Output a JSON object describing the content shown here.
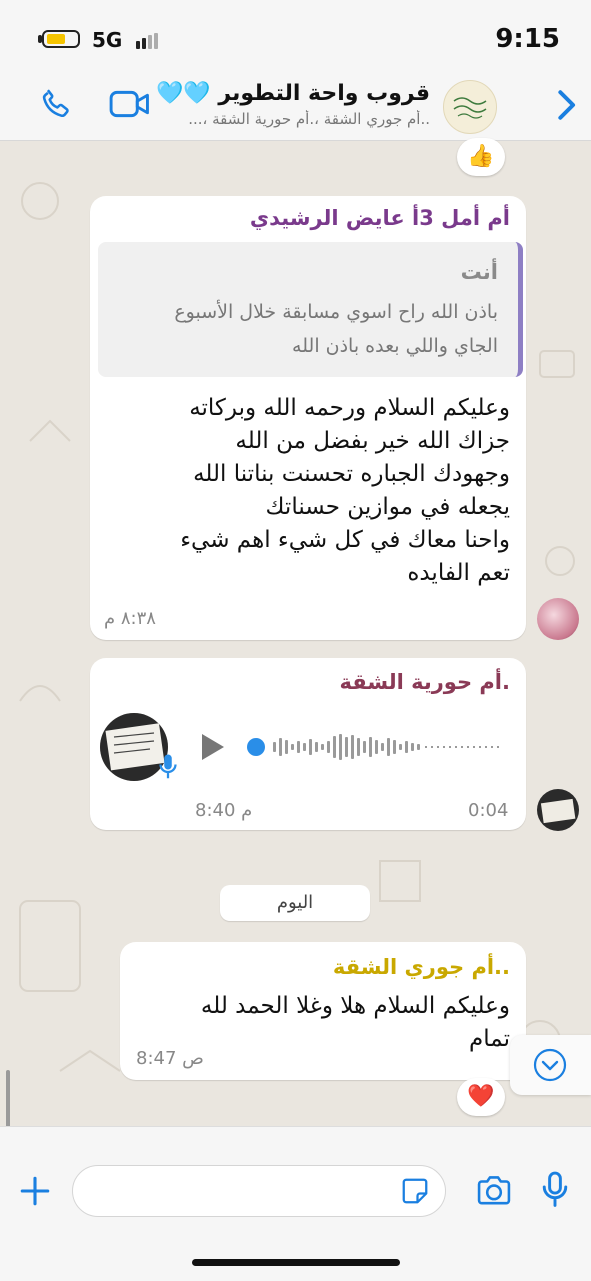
{
  "status_bar": {
    "time": "9:15",
    "network": "5G"
  },
  "header": {
    "title": "قروب واحة التطوير 🩵🩵",
    "subtitle": "..أم جوري الشقة ،.أم حورية الشقة ،..."
  },
  "colors": {
    "accent": "#1a7fe0",
    "sender_purple": "#7a3a8c",
    "sender_maroon": "#8a3a56",
    "sender_gold": "#c9a800"
  },
  "messages": [
    {
      "sender": "أم أمل  3أ عايض الرشيدي",
      "quote": {
        "author": "أنت",
        "lines": [
          "باذن الله راح اسوي مسابقة خلال الأسبوع",
          "الجاي واللي بعده باذن الله"
        ]
      },
      "lines": [
        "وعليكم السلام ورحمه الله وبركاته",
        "جزاك الله خير بفضل من الله",
        "وجهودك الجباره تحسنت بناتنا الله",
        "يجعله في موازين حسناتك",
        "واحنا معاك في كل شيء اهم شيء",
        "تعم الفايده"
      ],
      "time": "٨:٣٨ م"
    },
    {
      "sender": ".أم حورية الشقة",
      "type": "voice",
      "duration": "0:04",
      "time": "8:40 م"
    },
    {
      "sender": "..أم جوري الشقة",
      "lines": [
        "وعليكم السلام هلا وغلا الحمد لله",
        "تمام"
      ],
      "time": "8:47 ص",
      "reaction": "❤️"
    }
  ],
  "top_reaction": "👍",
  "day_separator": "اليوم"
}
